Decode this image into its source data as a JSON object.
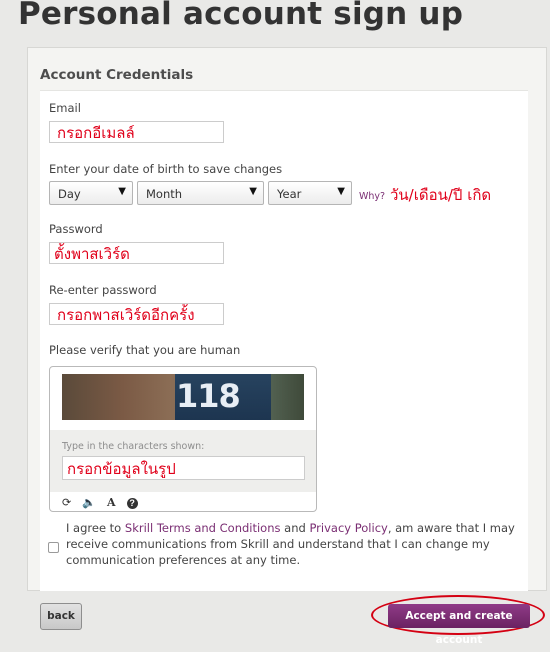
{
  "page": {
    "title": "Personal account sign up"
  },
  "section": {
    "title": "Account Credentials"
  },
  "form": {
    "email_label": "Email",
    "email_note": "กรอกอีเมลล์",
    "dob_label": "Enter your date of birth to save changes",
    "dob_day": "Day",
    "dob_month": "Month",
    "dob_year": "Year",
    "why_link": "Why?",
    "dob_note": "วัน/เดือน/ปี เกิด",
    "password_label": "Password",
    "password_note": "ตั้งพาสเวิร์ด",
    "reenter_label": "Re-enter password",
    "reenter_note": "กรอกพาสเวิร์ดอีกครั้ง",
    "human_label": "Please verify that you are human"
  },
  "captcha": {
    "image_text": "118",
    "hint": "Type in the characters shown:",
    "note": "กรอกข้อมูลในรูป",
    "tools": [
      "refresh-icon",
      "audio-icon",
      "font-icon",
      "help-icon"
    ]
  },
  "consent": {
    "part1": "I agree to ",
    "terms_link": "Skrill Terms and Conditions",
    "part2": " and ",
    "privacy_link": "Privacy Policy",
    "part3": ", am aware that I may receive communications from Skrill and understand that I can change my communication preferences at any time."
  },
  "actions": {
    "back_label": "back",
    "accept_label": "Accept and create account"
  },
  "colors": {
    "accent": "#7a2e73",
    "annotation": "#e0001a",
    "background": "#e9e9e7"
  }
}
